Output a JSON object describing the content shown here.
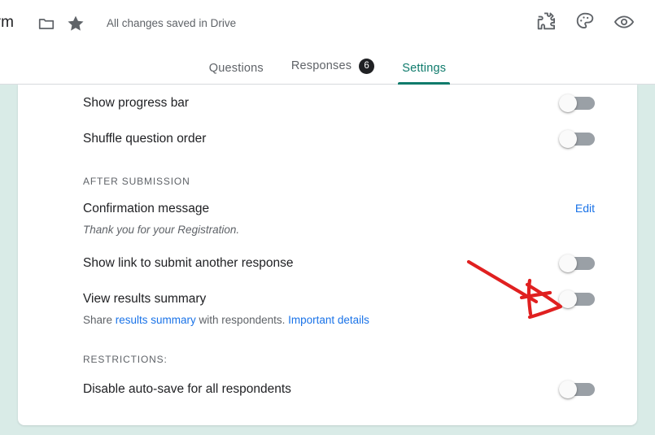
{
  "appbar": {
    "form_title": "orm",
    "save_status": "All changes saved in Drive",
    "icons": {
      "folder": "folder-icon",
      "star": "star-icon",
      "addons": "puzzle-addons-icon",
      "theme": "palette-theme-icon",
      "preview": "eye-preview-icon"
    }
  },
  "tabs": [
    {
      "label": "Questions",
      "active": false,
      "badge": null
    },
    {
      "label": "Responses",
      "active": false,
      "badge": "6"
    },
    {
      "label": "Settings",
      "active": true,
      "badge": null
    }
  ],
  "settings": {
    "rows": {
      "progress_bar": {
        "title": "Show progress bar",
        "toggle": "off"
      },
      "shuffle": {
        "title": "Shuffle question order",
        "toggle": "off"
      },
      "confirmation": {
        "title": "Confirmation message",
        "subtitle": "Thank you for your Registration.",
        "action_label": "Edit"
      },
      "show_link": {
        "title": "Show link to submit another response",
        "toggle": "off"
      },
      "view_results": {
        "title": "View results summary",
        "sub_prefix": "Share ",
        "sub_link1": "results summary",
        "sub_middle": " with respondents. ",
        "sub_link2": "Important details",
        "toggle": "off"
      },
      "auto_save": {
        "title": "Disable auto-save for all respondents",
        "toggle": "off"
      }
    },
    "section_labels": {
      "after_submission": "AFTER SUBMISSION",
      "restrictions": "RESTRICTIONS:"
    }
  },
  "annotation": {
    "type": "hand-drawn-arrow",
    "color": "#e02020",
    "points_to": "view-results-summary-toggle"
  },
  "colors": {
    "accent_teal": "#0f7b6c",
    "link_blue": "#1a73e8",
    "page_background": "#d9ebe7",
    "card_background": "#ffffff",
    "annotation_red": "#e02020"
  }
}
